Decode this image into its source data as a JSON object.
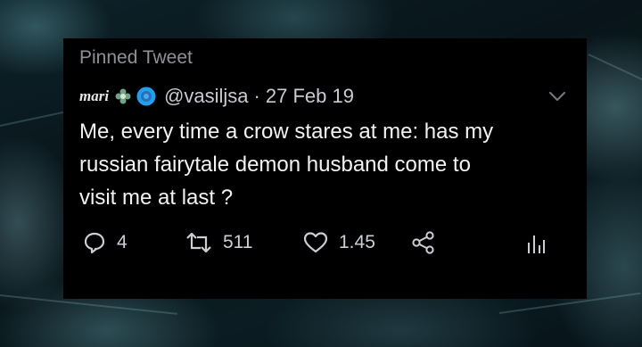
{
  "tweet": {
    "pinned_label": "Pinned Tweet",
    "display_name": "mari",
    "handle": "@vasiljsa",
    "separator": "·",
    "date": "27 Feb 19",
    "text": "Me, every time a crow stares at me: has my\nrussian fairytale demon husband come to\nvisit me at last ?",
    "replies": "4",
    "retweets": "511",
    "likes": "1.45",
    "icons": {
      "reply": "reply-icon",
      "retweet": "retweet-icon",
      "like": "heart-icon",
      "share": "share-icon",
      "analytics": "analytics-icon",
      "menu": "chevron-down-icon",
      "verified": "verified-badge-icon",
      "emoji": "flower-emoji-icon"
    },
    "colors": {
      "card_background": "#000000",
      "text": "#f2f2f2",
      "muted": "#8b9298",
      "verified": "#1da1f2"
    }
  }
}
